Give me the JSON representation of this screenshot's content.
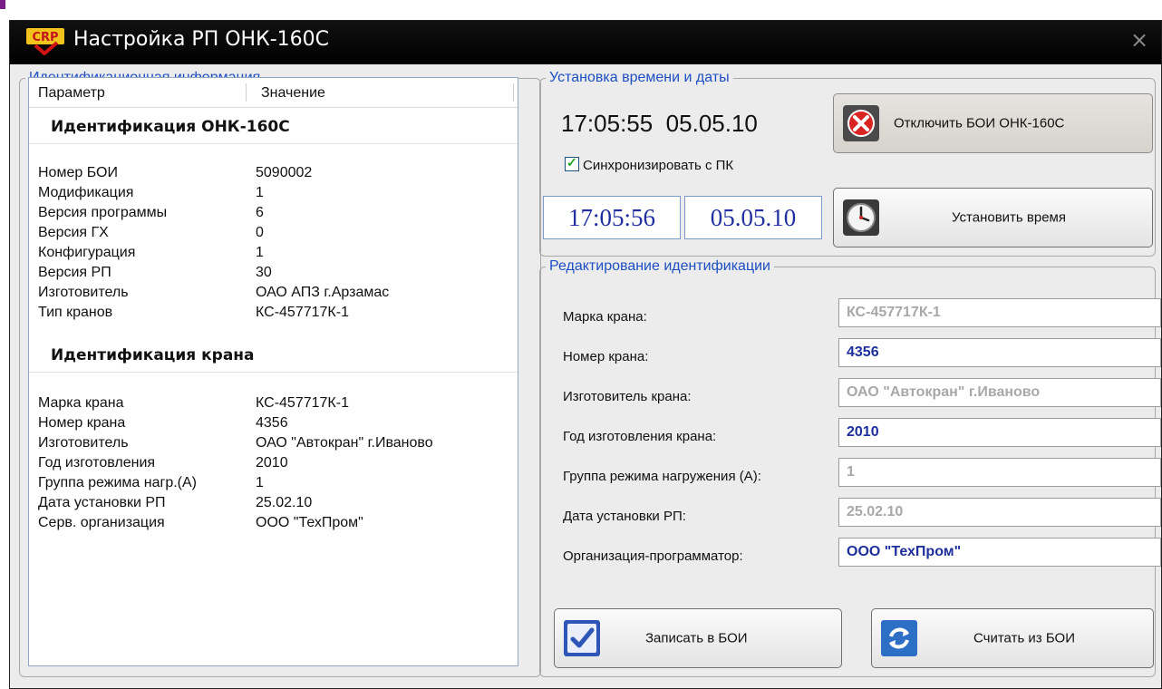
{
  "window": {
    "title": "Настройка РП ОНК-160С",
    "logo_text": "CRP",
    "close_glyph": "×"
  },
  "left_panel": {
    "legend": "Идентификационная информация",
    "columns": [
      "Параметр",
      "Значение"
    ],
    "group_onk": {
      "title": "Идентификация ОНК-160С",
      "rows": [
        {
          "param": "Номер БОИ",
          "value": "5090002"
        },
        {
          "param": "Модификация",
          "value": "1"
        },
        {
          "param": "Версия программы",
          "value": "6"
        },
        {
          "param": "Версия ГХ",
          "value": "0"
        },
        {
          "param": "Конфигурация",
          "value": "1"
        },
        {
          "param": "Версия РП",
          "value": "30"
        },
        {
          "param": "Изготовитель",
          "value": "ОАО АПЗ г.Арзамас"
        },
        {
          "param": "Тип кранов",
          "value": "КС-457717К-1"
        }
      ]
    },
    "group_crane": {
      "title": "Идентификация крана",
      "rows": [
        {
          "param": "Марка крана",
          "value": "КС-457717К-1"
        },
        {
          "param": "Номер крана",
          "value": "4356"
        },
        {
          "param": "Изготовитель",
          "value": "ОАО \"Автокран\" г.Иваново"
        },
        {
          "param": "Год изготовления",
          "value": "2010"
        },
        {
          "param": "Группа режима нагр.(А)",
          "value": "1"
        },
        {
          "param": "Дата установки РП",
          "value": "25.02.10"
        },
        {
          "param": "Серв. организация",
          "value": "ООО \"ТехПром\""
        }
      ]
    }
  },
  "time_panel": {
    "legend": "Установка времени и даты",
    "device_time": "17:05:55",
    "device_date": "05.05.10",
    "disconnect_button": "Отключить БОИ ОНК-160С",
    "sync_checkbox": {
      "label": "Синхронизировать с ПК",
      "checked": true
    },
    "pc_time": "17:05:56",
    "pc_date": "05.05.10",
    "set_time_button": "Установить время"
  },
  "edit_panel": {
    "legend": "Редактирование идентификации",
    "fields": [
      {
        "label": "Марка крана:",
        "value": "КС-457717К-1",
        "enabled": false
      },
      {
        "label": "Номер крана:",
        "value": "4356",
        "enabled": true
      },
      {
        "label": "Изготовитель крана:",
        "value": "ОАО \"Автокран\" г.Иваново",
        "enabled": false
      },
      {
        "label": "Год изготовления крана:",
        "value": "2010",
        "enabled": true
      },
      {
        "label": "Группа режима нагружения (А):",
        "value": "1",
        "enabled": false
      },
      {
        "label": "Дата установки РП:",
        "value": "25.02.10",
        "enabled": false
      },
      {
        "label": "Организация-программатор:",
        "value": "ООО \"ТехПром\"",
        "enabled": true
      }
    ],
    "write_button": "Записать в БОИ",
    "read_button": "Считать из БОИ"
  },
  "colors": {
    "title_bar": "#000000",
    "legend_text": "#1c4fc4",
    "active_value": "#1d2f9c",
    "disabled_value": "#a8a8a8"
  }
}
